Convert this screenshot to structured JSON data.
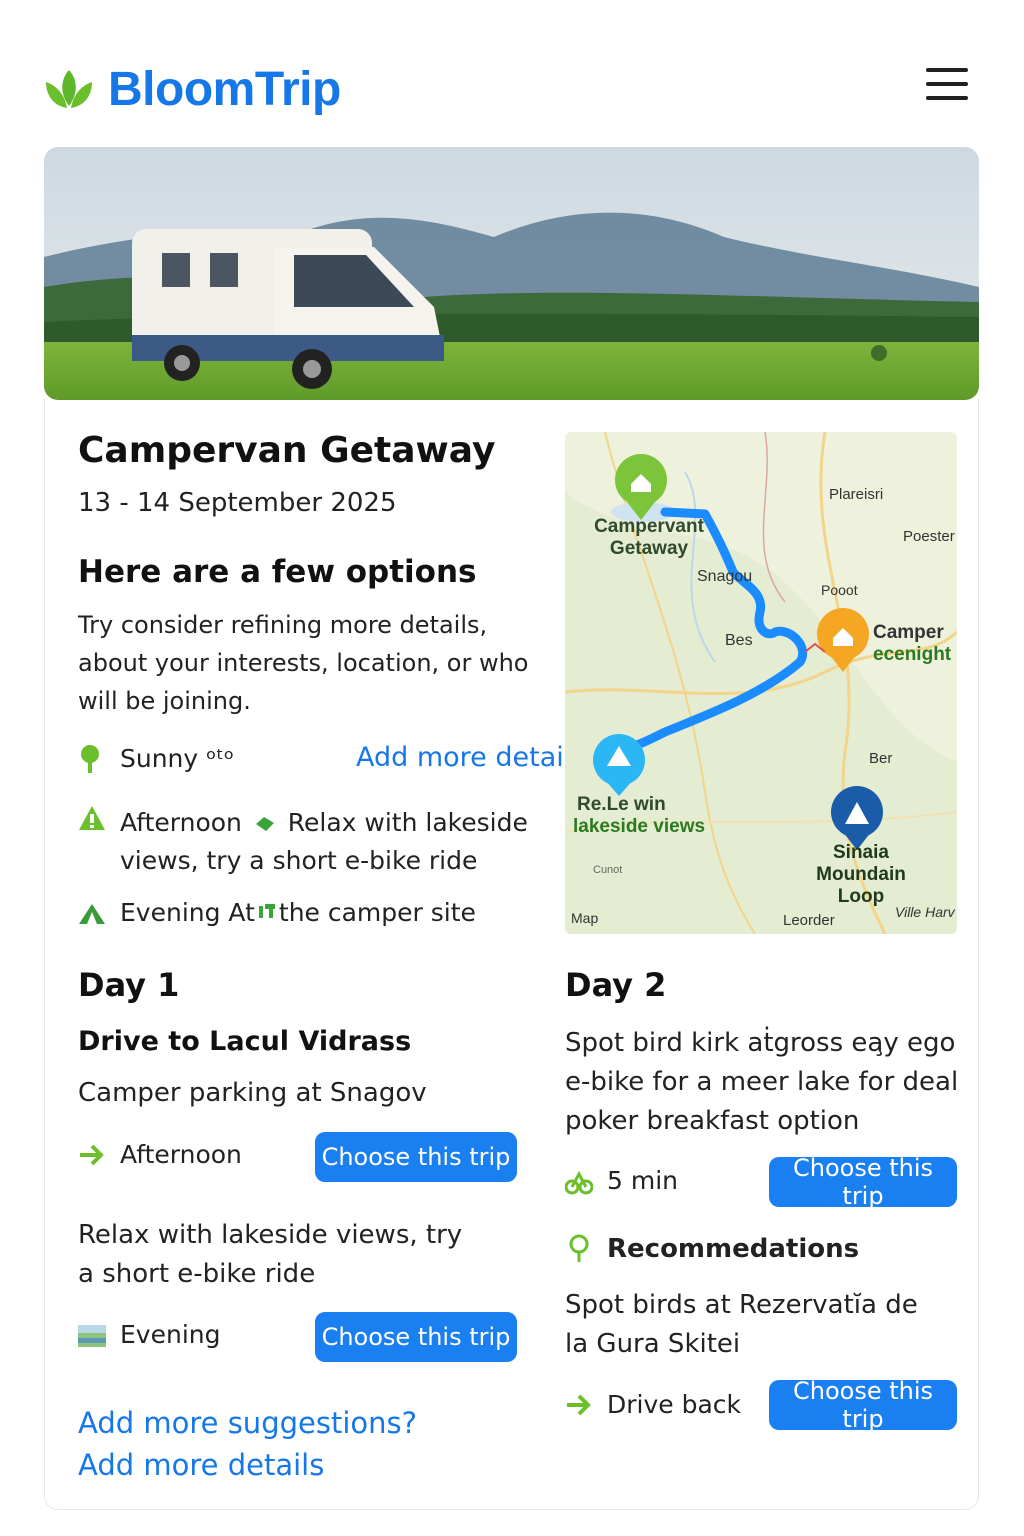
{
  "app": {
    "name": "BloomTrip"
  },
  "trip": {
    "title": "Campervan Getaway",
    "dates": "13 - 14 September 2025"
  },
  "options": {
    "heading": "Here are a few options",
    "text": "Try consider refining more details, about your interests, location, or who will be joining.",
    "add_details_link": "Add more details",
    "items": [
      {
        "icon": "sun-pin-icon",
        "text": "Sunny ᵒᵗᵒ"
      },
      {
        "icon": "warning-tent-icon",
        "text": "Afternoon",
        "text2": "Relax with lakeside views, try a short e-bike ride"
      },
      {
        "icon": "tent-icon",
        "text": "Evening At",
        "text2": "the camper site"
      }
    ]
  },
  "map": {
    "labels": {
      "campervan": "Campervant Getaway",
      "plareisri": "Plareisri",
      "poester": "Poester",
      "snagou": "Snagou",
      "pooot": "Pooot",
      "bes": "Bes",
      "camper": "Camper",
      "ecenight": "ecenight",
      "ber": "Ber",
      "relewin": "Re.Le win",
      "lakeside": "lakeside views",
      "sinaia": "Sinaia Moundain Loop",
      "cunot": "Cunot",
      "map": "Map",
      "leorder": "Leorder",
      "villeharv": "Ville Harv"
    }
  },
  "day1": {
    "heading": "Day 1",
    "title": "Drive to Lacul Vidrass",
    "subtitle": "Camper parking at Snagov",
    "slot1": "Afternoon",
    "text2": "Relax with lakeside views, try a short e-bike ride",
    "slot2": "Evening",
    "button": "Choose this trip"
  },
  "day2": {
    "heading": "Day 2",
    "text": "Spot bird kirk aṫgross ea̧y ego e-bike for a meer lake for deal poker breakfast option",
    "duration": "5 min",
    "recommendations": "Recommedations",
    "rec_text": "Spot birds at Rezervatĭa de la Gura Skitei",
    "drive_back": "Drive back",
    "button": "Choose this trip"
  },
  "footer": {
    "suggestions": "Add more suggestions?",
    "details": "Add more details"
  },
  "colors": {
    "brand": "#1677e8",
    "button": "#1a7ff0",
    "green": "#6abf2a"
  }
}
